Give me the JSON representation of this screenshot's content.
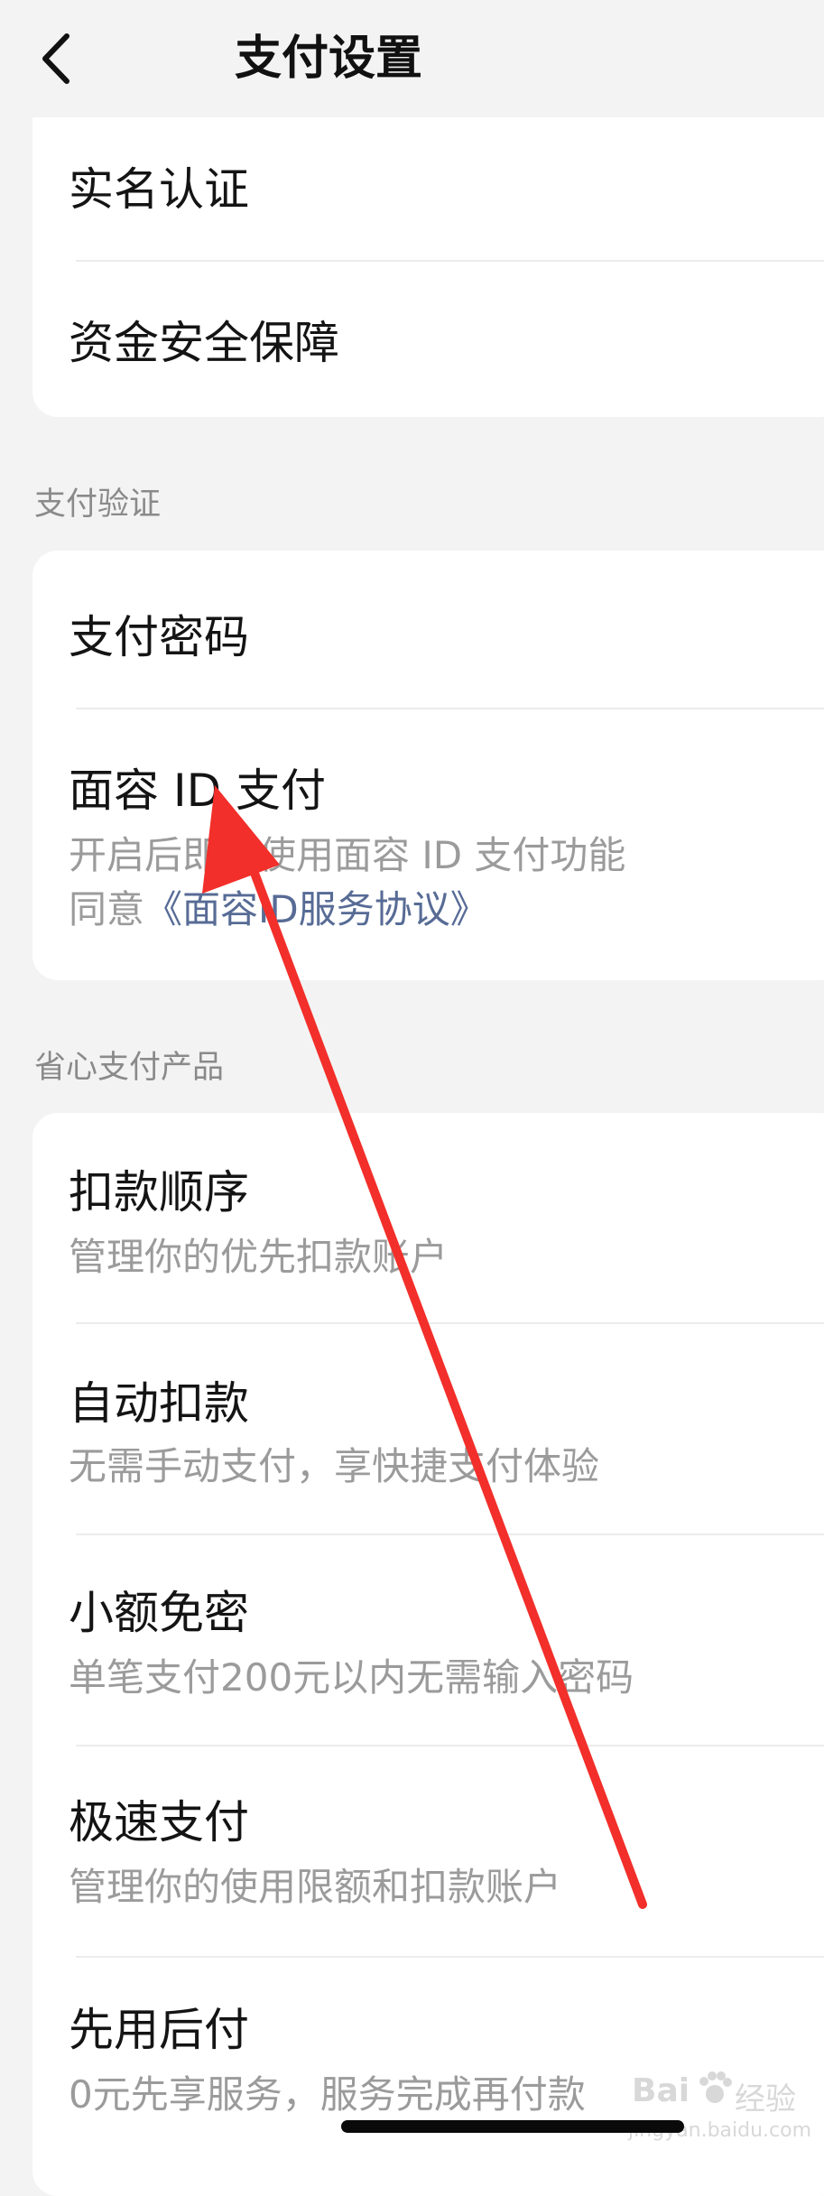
{
  "header": {
    "title": "支付设置",
    "back_icon": "chevron-left-icon"
  },
  "account_card": {
    "items": [
      {
        "label": "实名认证"
      },
      {
        "label": "资金安全保障"
      }
    ]
  },
  "payment_verification": {
    "section_title": "支付验证",
    "items": [
      {
        "label": "支付密码"
      },
      {
        "label": "面容 ID 支付",
        "sub": "开启后即可使用面容 ID 支付功能",
        "agree_prefix": "同意",
        "agree_link": "《面容ID服务协议》"
      }
    ]
  },
  "smart_payment": {
    "section_title": "省心支付产品",
    "items": [
      {
        "label": "扣款顺序",
        "sub": "管理你的优先扣款账户"
      },
      {
        "label": "自动扣款",
        "sub": "无需手动支付，享快捷支付体验"
      },
      {
        "label": "小额免密",
        "sub": "单笔支付200元以内无需输入密码"
      },
      {
        "label": "极速支付",
        "sub": "管理你的使用限额和扣款账户"
      },
      {
        "label": "先用后付",
        "sub": "0元先享服务，服务完成再付款"
      }
    ]
  },
  "watermark": {
    "brand": "Bai",
    "brand2": "经验",
    "url": "jingyan.baidu.com"
  },
  "colors": {
    "background": "#f3f3f3",
    "card": "#ffffff",
    "link": "#576b95",
    "annotation_arrow": "#f22f2a"
  }
}
